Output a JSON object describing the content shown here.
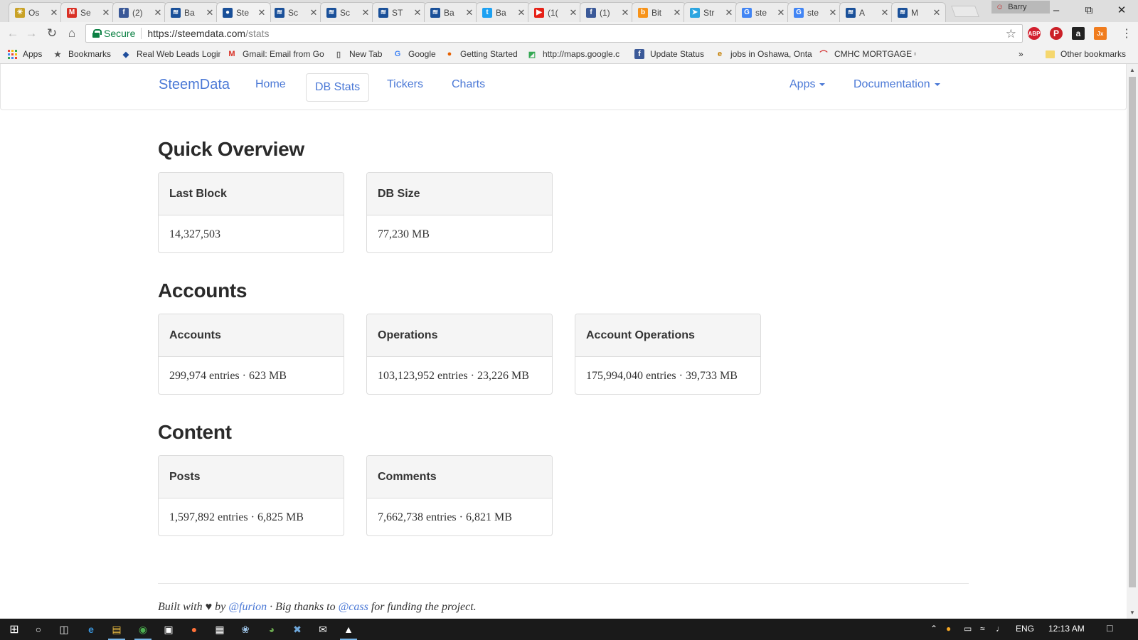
{
  "browser": {
    "tabs": [
      {
        "title": "Os",
        "icon": "sun-icon",
        "color": "#c9a227"
      },
      {
        "title": "Se",
        "icon": "gmail-icon",
        "color": "#d93025"
      },
      {
        "title": "(2)",
        "icon": "facebook-icon",
        "color": "#3b5998"
      },
      {
        "title": "Ba",
        "icon": "steemit-icon",
        "color": "#1a5099"
      },
      {
        "title": "Ste",
        "icon": "steemdata-icon",
        "color": "#1a5099"
      },
      {
        "title": "Sc",
        "icon": "steemit-icon",
        "color": "#1a5099"
      },
      {
        "title": "Sc",
        "icon": "steemit-icon",
        "color": "#1a5099"
      },
      {
        "title": "ST",
        "icon": "steemit-icon",
        "color": "#1a5099"
      },
      {
        "title": "Ba",
        "icon": "steemit-icon",
        "color": "#1a5099"
      },
      {
        "title": "Ba",
        "icon": "twitter-icon",
        "color": "#1da1f2"
      },
      {
        "title": "(1(",
        "icon": "youtube-icon",
        "color": "#e62117"
      },
      {
        "title": "(1)",
        "icon": "facebook-icon",
        "color": "#3b5998"
      },
      {
        "title": "Bit",
        "icon": "bitcoin-icon",
        "color": "#f7931a"
      },
      {
        "title": "Str",
        "icon": "telegram-icon",
        "color": "#2ca5e0"
      },
      {
        "title": "ste",
        "icon": "google-icon",
        "color": "#4285f4"
      },
      {
        "title": "ste",
        "icon": "google-icon",
        "color": "#4285f4"
      },
      {
        "title": "A",
        "icon": "steemit-icon",
        "color": "#1a5099"
      },
      {
        "title": "M",
        "icon": "steemit-icon",
        "color": "#1a5099"
      }
    ],
    "active_tab": 4,
    "profile_name": "Barry",
    "secure_label": "Secure",
    "url_host": "https://steemdata.com",
    "url_path": "/stats",
    "bookmarks": [
      {
        "label": "Apps",
        "icon": "apps-grid-icon"
      },
      {
        "label": "Bookmarks",
        "icon": "star-icon"
      },
      {
        "label": "Real Web Leads Login",
        "icon": "leads-icon"
      },
      {
        "label": "Gmail: Email from Go",
        "icon": "gmail-icon"
      },
      {
        "label": "New Tab",
        "icon": "page-icon"
      },
      {
        "label": "Google",
        "icon": "google-icon"
      },
      {
        "label": "Getting Started",
        "icon": "firefox-icon"
      },
      {
        "label": "http://maps.google.c",
        "icon": "maps-icon"
      },
      {
        "label": "Update Status",
        "icon": "facebook-icon"
      },
      {
        "label": "jobs in Oshawa, Onta",
        "icon": "ie-icon"
      },
      {
        "label": "CMHC MORTGAGE C",
        "icon": "cmhc-icon"
      }
    ],
    "other_bookmarks": "Other bookmarks",
    "overflow": "»"
  },
  "site": {
    "brand": "SteemData",
    "nav": [
      "Home",
      "DB Stats",
      "Tickers",
      "Charts"
    ],
    "active_nav": "DB Stats",
    "apps": "Apps",
    "documentation": "Documentation"
  },
  "sections": [
    {
      "title": "Quick Overview",
      "cards": [
        {
          "label": "Last Block",
          "value": "14,327,503"
        },
        {
          "label": "DB Size",
          "value": "77,230 MB"
        }
      ]
    },
    {
      "title": "Accounts",
      "cards": [
        {
          "label": "Accounts",
          "value": "299,974 entries · 623 MB"
        },
        {
          "label": "Operations",
          "value": "103,123,952 entries · 23,226 MB"
        },
        {
          "label": "Account Operations",
          "value": "175,994,040 entries · 39,733 MB"
        }
      ]
    },
    {
      "title": "Content",
      "cards": [
        {
          "label": "Posts",
          "value": "1,597,892 entries · 6,825 MB"
        },
        {
          "label": "Comments",
          "value": "7,662,738 entries · 6,821 MB"
        }
      ]
    }
  ],
  "footer": {
    "built_with": "Built with ♥ by ",
    "author": "@furion",
    "thanks": " · Big thanks to ",
    "sponsor": "@cass",
    "funding": " for funding the project."
  },
  "taskbar": {
    "language": "ENG",
    "time": "12:13 AM"
  },
  "colors": {
    "link": "#4a78d6",
    "secure": "#0b8043"
  }
}
